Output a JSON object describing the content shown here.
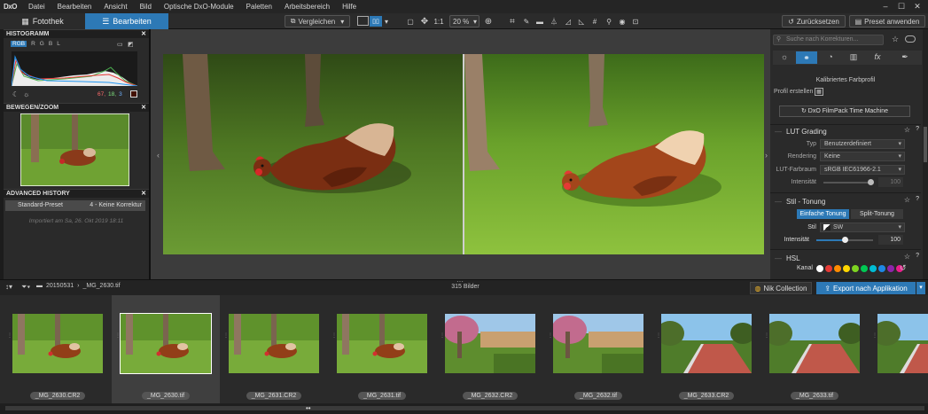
{
  "app": {
    "logo": "DxO"
  },
  "menu": [
    "Datei",
    "Bearbeiten",
    "Ansicht",
    "Bild",
    "Optische DxO-Module",
    "Paletten",
    "Arbeitsbereich",
    "Hilfe"
  ],
  "tabs": {
    "fotothek": "Fotothek",
    "bearbeiten": "Bearbeiten"
  },
  "toolbar": {
    "compare": "Vergleichen",
    "zoom_1to1": "1:1",
    "zoom": "20 %",
    "reset": "Zurücksetzen",
    "apply_preset": "Preset anwenden"
  },
  "histogram": {
    "title": "HISTOGRAMM",
    "channels": [
      "RGB",
      "R",
      "G",
      "B",
      "L"
    ],
    "readout": [
      "67,",
      "18,",
      "3"
    ]
  },
  "move_zoom": {
    "title": "BEWEGEN/ZOOM"
  },
  "history": {
    "title": "ADVANCED HISTORY",
    "item_left": "Standard-Preset",
    "item_right": "4 - Keine Korrektur",
    "imported": "Importiert am Sa, 26. Okt 2019 18:11"
  },
  "right": {
    "search_placeholder": "Suche nach Korrekturen...",
    "calibrated_profile": "Kalibriertes Farbprofil",
    "profile_create": "Profil erstellen",
    "filmpack_button": "DxO FilmPack Time Machine",
    "lut": {
      "title": "LUT Grading",
      "type_label": "Typ",
      "type_value": "Benutzerdefiniert",
      "rendering_label": "Rendering",
      "rendering_value": "Keine",
      "colorspace_label": "LUT-Farbraum",
      "colorspace_value": "sRGB IEC61966-2.1",
      "intensity_label": "Intensität",
      "intensity_value": "100",
      "intensity_level": 0.95
    },
    "tone": {
      "title": "Stil - Tonung",
      "simple": "Einfache Tonung",
      "split": "Split-Tonung",
      "style_label": "Stil",
      "style_value": "SW",
      "intensity_label": "Intensität",
      "intensity_value": "100",
      "intensity_level": 0.5
    },
    "hsl": {
      "title": "HSL",
      "channel_label": "Kanal",
      "swatches": [
        "#ffffff",
        "#e53935",
        "#ff8c00",
        "#ffd600",
        "#7ed321",
        "#00c853",
        "#00bcd4",
        "#1e88e5",
        "#8e24aa",
        "#e91e8c"
      ]
    }
  },
  "filmbar": {
    "path_folder": "20150531",
    "path_file": "_MG_2630.tif",
    "count": "315 Bilder",
    "nik": "Nik Collection",
    "export": "Export nach Applikation"
  },
  "thumbnails": [
    {
      "label": "_MG_2630.CR2",
      "kind": "hen",
      "selected": false
    },
    {
      "label": "_MG_2630.tif",
      "kind": "hen",
      "selected": true
    },
    {
      "label": "_MG_2631.CR2",
      "kind": "hen",
      "selected": false
    },
    {
      "label": "_MG_2631.tif",
      "kind": "hen",
      "selected": false
    },
    {
      "label": "_MG_2632.CR2",
      "kind": "garden",
      "selected": false
    },
    {
      "label": "_MG_2632.tif",
      "kind": "garden",
      "selected": false
    },
    {
      "label": "_MG_2633.CR2",
      "kind": "court",
      "selected": false
    },
    {
      "label": "_MG_2633.tif",
      "kind": "court",
      "selected": false
    },
    {
      "label": "",
      "kind": "court",
      "selected": false
    }
  ]
}
